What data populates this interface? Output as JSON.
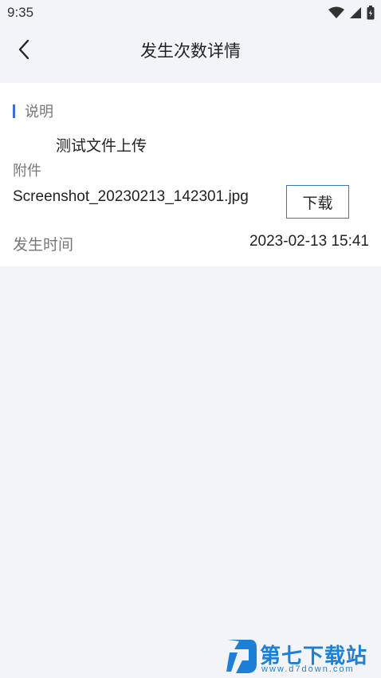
{
  "status_bar": {
    "time": "9:35"
  },
  "header": {
    "title": "发生次数详情"
  },
  "detail": {
    "section_title": "说明",
    "description": "测试文件上传",
    "attachment_label": "附件",
    "attachment_file": "Screenshot_20230213_142301.jpg",
    "download_label": "下载",
    "time_label": "发生时间",
    "time_value": "2023-02-13 15:41"
  },
  "watermark": {
    "name": "第七下载站",
    "url": "www.d7down.com"
  },
  "colors": {
    "accent": "#3a6fd8",
    "button_border": "#3b78c0",
    "background": "#f3f4f8",
    "watermark": "#1e7fd6"
  },
  "icons": {
    "back": "back-arrow-icon",
    "wifi": "wifi-icon",
    "signal": "signal-icon",
    "battery": "battery-icon"
  }
}
